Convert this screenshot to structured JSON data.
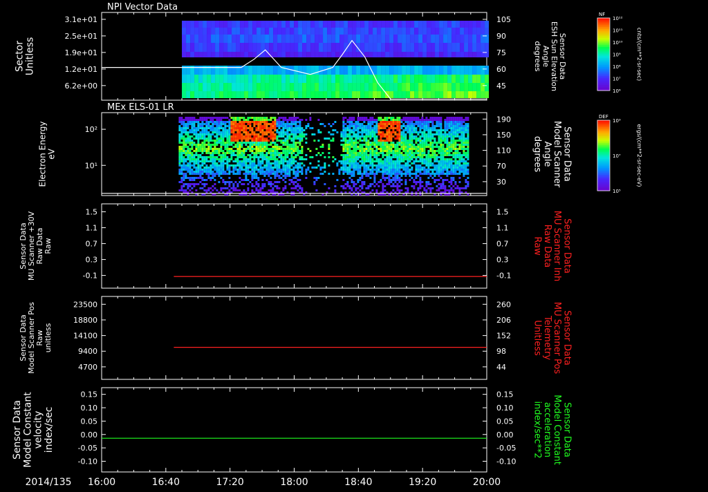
{
  "colors": {
    "background": "#000000",
    "text": "#ffffff",
    "red": "#ff2020",
    "green": "#20ff20",
    "white": "#ffffff"
  },
  "time_axis": {
    "date_label": "2014/135",
    "ticks": [
      "16:00",
      "16:40",
      "17:20",
      "18:00",
      "18:40",
      "19:20",
      "20:00"
    ]
  },
  "chart_data": [
    {
      "id": "npi",
      "type": "heatmap",
      "title": "NPI Vector Data",
      "ylabel_lines": [
        "Sector",
        "Unitless"
      ],
      "yticks": [
        "3.1e+01",
        "2.5e+01",
        "1.9e+01",
        "1.2e+01",
        "6.2e+00"
      ],
      "right_yticks": [
        "105",
        "90",
        "75",
        "60",
        "45"
      ],
      "right_label_lines": [
        "Sensor Data",
        "ESH Sun Elevation",
        "Angle",
        "degrees"
      ],
      "right_label_color": "#ffffff",
      "colorbar": {
        "label": "NF",
        "ticks": [
          "10¹²",
          "10¹¹",
          "10¹⁰",
          "10⁹",
          "10⁸",
          "10⁷",
          "10⁶"
        ],
        "unit": "cnts/(cm**2-sr-sec)"
      },
      "data_start": "16:50",
      "line_series": {
        "name": "ESH Sun Elevation Angle",
        "color": "#ffffff",
        "x": [
          "16:00",
          "17:27",
          "17:35",
          "17:42",
          "17:52",
          "18:10",
          "18:24",
          "18:30",
          "18:36",
          "18:44",
          "18:52",
          "19:00",
          "20:00"
        ],
        "y": [
          63,
          63,
          70,
          78,
          63,
          57,
          63,
          74,
          86,
          72,
          50,
          36,
          36
        ]
      }
    },
    {
      "id": "els",
      "type": "heatmap",
      "title": "MEx ELS-01 LR",
      "ylabel_lines": [
        "Electron Energy",
        "eV"
      ],
      "yticks": [
        "10²",
        "10¹"
      ],
      "right_yticks": [
        "190",
        "150",
        "110",
        "70",
        "30"
      ],
      "right_label_lines": [
        "Sensor Data",
        "Model Scanner",
        "Angle",
        "degrees"
      ],
      "right_label_color": "#ffffff",
      "colorbar": {
        "label": "DEF",
        "ticks": [
          "10⁹",
          "10⁷",
          "10⁵"
        ],
        "unit": "ergs/(cm**2-sr-sec-eV)"
      },
      "data_range": [
        "16:48",
        "19:48"
      ],
      "line_series": {
        "name": "Model Scanner Angle",
        "color": "#ffffff",
        "x": [
          "16:00",
          "20:00"
        ],
        "y": [
          10,
          10
        ]
      }
    },
    {
      "id": "mu_inh",
      "type": "line",
      "ylabel_lines": [
        "Sensor Data",
        "MU Scanner +30V",
        "Raw Data",
        "Raw"
      ],
      "yticks": [
        "1.5",
        "1.1",
        "0.7",
        "0.3",
        "-0.1"
      ],
      "right_yticks": [
        "1.5",
        "1.1",
        "0.7",
        "0.3",
        "-0.1"
      ],
      "right_label_lines": [
        "Sensor Data",
        "MU Scanner Inh",
        "Raw Data",
        "Raw"
      ],
      "right_label_color": "#ff2020",
      "ylim": [
        -0.3,
        1.5
      ],
      "series": [
        {
          "name": "MU Scanner Inh",
          "color": "#ff2020",
          "x": [
            "16:45",
            "20:00"
          ],
          "y": [
            -0.05,
            -0.05
          ]
        }
      ]
    },
    {
      "id": "mu_pos",
      "type": "line",
      "ylabel_lines": [
        "Sensor Data",
        "Model Scanner Pos",
        "Raw",
        "unitless"
      ],
      "yticks": [
        "23500",
        "18800",
        "14100",
        "9400",
        "4700"
      ],
      "right_yticks": [
        "260",
        "206",
        "152",
        "98",
        "44"
      ],
      "right_label_lines": [
        "Sensor Data",
        "MU Scanner Pos",
        "Telemetry",
        "Unitless"
      ],
      "right_label_color": "#ff2020",
      "ylim": [
        -17,
        260
      ],
      "series": [
        {
          "name": "MU Scanner Pos",
          "color": "#ff2020",
          "x": [
            "16:45",
            "20:00"
          ],
          "y": [
            90,
            90
          ]
        }
      ]
    },
    {
      "id": "model_const",
      "type": "line",
      "ylabel_lines": [
        "Sensor Data",
        "Model Constant",
        "velocity",
        "index/sec"
      ],
      "yticks": [
        "0.15",
        "0.10",
        "0.05",
        "0.00",
        "-0.05",
        "-0.10"
      ],
      "right_yticks": [
        "0.15",
        "0.10",
        "0.05",
        "0.00",
        "-0.05",
        "-0.10"
      ],
      "right_label_lines": [
        "Sensor Data",
        "Model Constant",
        "acceleration",
        "index/sec**2"
      ],
      "right_label_color": "#20ff20",
      "ylim": [
        -0.1,
        0.15
      ],
      "series": [
        {
          "name": "Model Constant acceleration",
          "color": "#20ff20",
          "x": [
            "16:00",
            "20:00"
          ],
          "y": [
            0.0,
            0.0
          ]
        }
      ]
    }
  ]
}
